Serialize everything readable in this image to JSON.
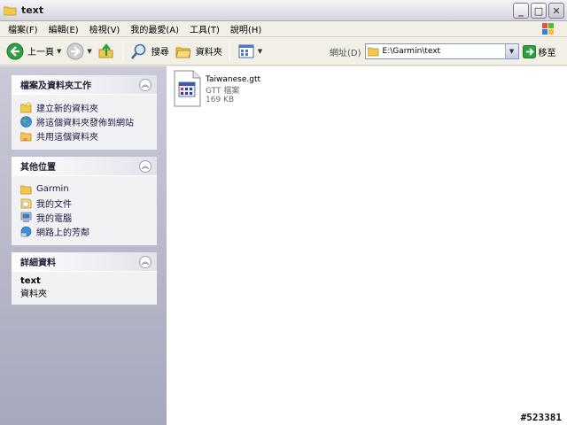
{
  "window": {
    "title": "text",
    "buttons": {
      "minimize": "_",
      "maximize": "□",
      "close": "✕"
    }
  },
  "menu": {
    "items": [
      "檔案(F)",
      "編輯(E)",
      "檢視(V)",
      "我的最愛(A)",
      "工具(T)",
      "說明(H)"
    ]
  },
  "toolbar": {
    "back_label": "上一頁",
    "search_label": "搜尋",
    "folders_label": "資料夾"
  },
  "address": {
    "label": "網址(D)",
    "value": "E:\\Garmin\\text",
    "go_label": "移至"
  },
  "panels": {
    "tasks": {
      "title": "檔案及資料夾工作",
      "items": [
        "建立新的資料夾",
        "將這個資料夾發佈到網站",
        "共用這個資料夾"
      ]
    },
    "places": {
      "title": "其他位置",
      "items": [
        "Garmin",
        "我的文件",
        "我的電腦",
        "網路上的芳鄰"
      ]
    },
    "details": {
      "title": "詳細資料",
      "name": "text",
      "type": "資料夾"
    }
  },
  "files": [
    {
      "name": "Taiwanese.gtt",
      "type": "GTT 檔案",
      "size": "169 KB"
    }
  ],
  "watermark": "#523381",
  "colors": {
    "pane_top": "#c9cad8",
    "pane_bottom": "#a6a8bc",
    "link_text": "#1a1a44",
    "back_green": "#2ea043",
    "go_green": "#2ea043"
  }
}
